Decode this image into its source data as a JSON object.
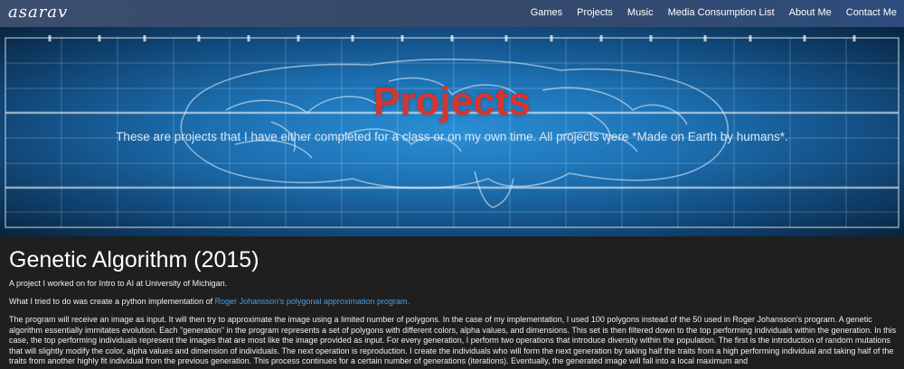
{
  "navbar": {
    "brand": "asarav",
    "links": [
      "Games",
      "Projects",
      "Music",
      "Media Consumption List",
      "About Me",
      "Contact Me"
    ]
  },
  "hero": {
    "title": "Projects",
    "subtitle": "These are projects that I have either completed for a class or on my own time. All projects were *Made on Earth by humans*.",
    "title_color": "#d6352f"
  },
  "project": {
    "title": "Genetic Algorithm (2015)",
    "intro": "A project I worked on for Intro to AI at University of Michigan.",
    "goal_prefix": "What I tried to do was create a python implementation of ",
    "goal_link": "Roger Johansson's polygonal approximation program.",
    "description": "The program will receive an image as input. It will then try to approximate the image using a limited number of polygons. In the case of my implementation, I used 100 polygons instead of the 50 used in Roger Johansson's program. A genetic algorithm essentially immitates evolution. Each \"generation\" in the program represents a set of polygons with different colors, alpha values, and dimensions. This set is then filtered down to the top performing individuals within the generation. In this case, the top performing individuals represent the images that are most like the image provided as input. For every generation, I perform two operations that introduce diversity within the population. The first is the introduction of random mutations that will slightly modify the color, alpha values and dimension of individuals. The next operation is reproduction. I create the individuals who will form the next generation by taking half the traits from a high performing individual and taking half of the traits from another highly fit individual from the previous generation. This process continues for a certain number of generations (iterations). Eventually, the generated image will fall into a local maximum and"
  },
  "colors": {
    "navbar": "#34496b",
    "background": "#1f1f1f",
    "link": "#4c9ee0"
  }
}
